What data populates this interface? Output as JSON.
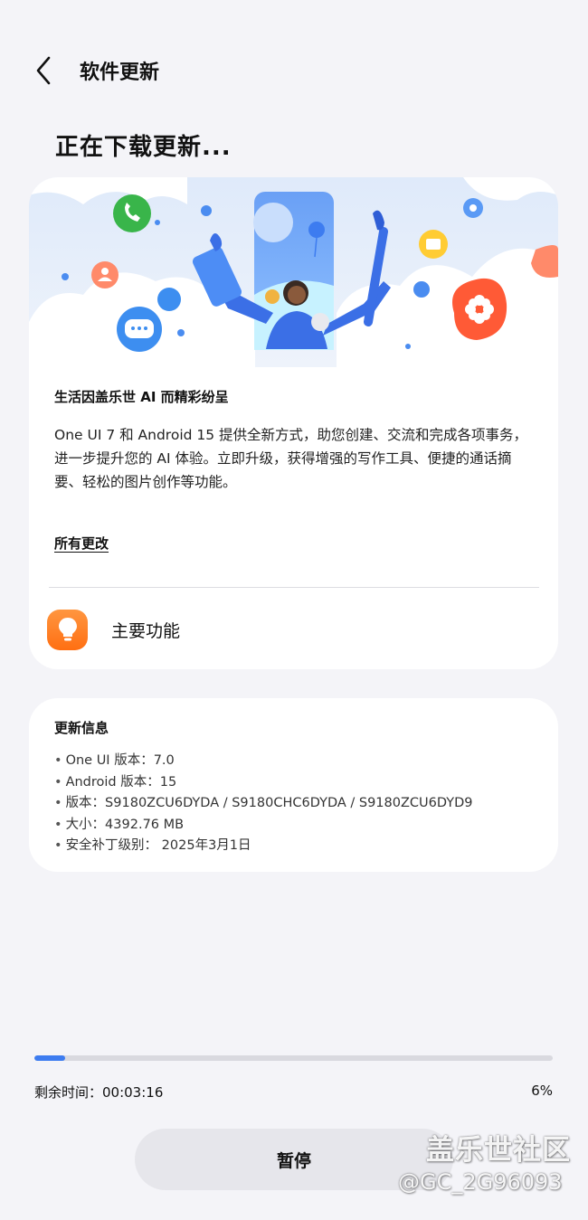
{
  "header": {
    "back_icon": "chevron-left-icon",
    "title": "软件更新"
  },
  "status": {
    "title": "正在下载更新..."
  },
  "promo": {
    "headline": "生活因盖乐世 AI 而精彩纷呈",
    "description": "One UI 7 和 Android 15 提供全新方式，助您创建、交流和完成各项事务，进一步提升您的 AI 体验。立即升级，获得增强的写作工具、便捷的通话摘要、轻松的图片创作等功能。",
    "all_changes_link": "所有更改",
    "feature_label": "主要功能",
    "feature_icon": "lightbulb-icon"
  },
  "update_info": {
    "title": "更新信息",
    "items": [
      "One UI 版本：7.0",
      "Android 版本：15",
      "版本：S9180ZCU6DYDA / S9180CHC6DYDA / S9180ZCU6DYD9",
      "大小：4392.76 MB",
      "安全补丁级别： 2025年3月1日"
    ]
  },
  "download": {
    "progress_percent": 6,
    "time_left": "剩余时间：00:03:16",
    "percent_text": "6%"
  },
  "pause_button": "暂停",
  "watermark": {
    "line1": "盖乐世社区",
    "line2": "@GC_2G96093"
  },
  "colors": {
    "accent": "#3d7cf0",
    "background": "#f4f4f8",
    "card": "#ffffff",
    "feature_icon": "#ff7a1a"
  }
}
